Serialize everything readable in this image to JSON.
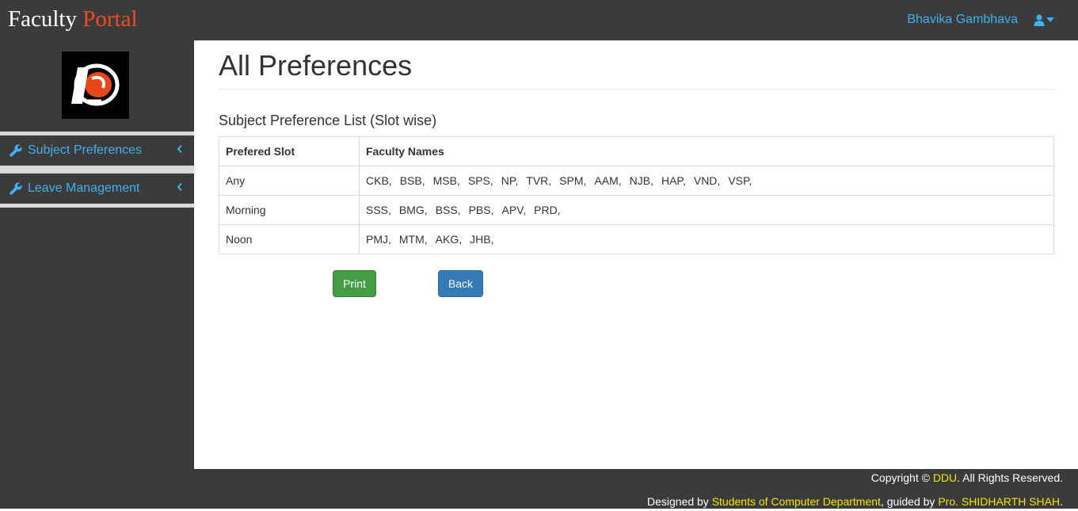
{
  "header": {
    "brand_part1": "Faculty",
    "brand_part2": "Portal",
    "user_name": "Bhavika Gambhava",
    "colors": {
      "bar": "#3b3b3b",
      "brand_accent": "#ee4b24",
      "link": "#3fb0f0"
    }
  },
  "sidebar": {
    "logo": "ddu-logo",
    "items": [
      {
        "label": "Subject Preferences",
        "icon": "wrench-icon"
      },
      {
        "label": "Leave Management",
        "icon": "wrench-icon"
      }
    ]
  },
  "main": {
    "title": "All Preferences",
    "section_heading": "Subject Preference List (Slot wise)",
    "table": {
      "headers": [
        "Prefered Slot",
        "Faculty Names"
      ],
      "rows": [
        {
          "slot": "Any",
          "names": [
            "CKB,",
            "BSB,",
            "MSB,",
            "SPS,",
            "NP,",
            "TVR,",
            "SPM,",
            "AAM,",
            "NJB,",
            "HAP,",
            "VND,",
            "VSP,"
          ]
        },
        {
          "slot": "Morning",
          "names": [
            "SSS,",
            "BMG,",
            "BSS,",
            "PBS,",
            "APV,",
            "PRD,"
          ]
        },
        {
          "slot": "Noon",
          "names": [
            "PMJ,",
            "MTM,",
            "AKG,",
            "JHB,"
          ]
        }
      ]
    },
    "buttons": {
      "print": "Print",
      "back": "Back"
    }
  },
  "footer": {
    "copyright_prefix": "Copyright ©",
    "copyright_org": "DDU",
    "copyright_suffix": ". All Rights Reserved.",
    "designed_prefix": "Designed by",
    "designed_by": "Students of Computer Department",
    "guided_prefix": ", guided by",
    "guided_by": "Pro. SHIDHARTH SHAH",
    "end": ".",
    "highlight_color": "#f5e400"
  }
}
